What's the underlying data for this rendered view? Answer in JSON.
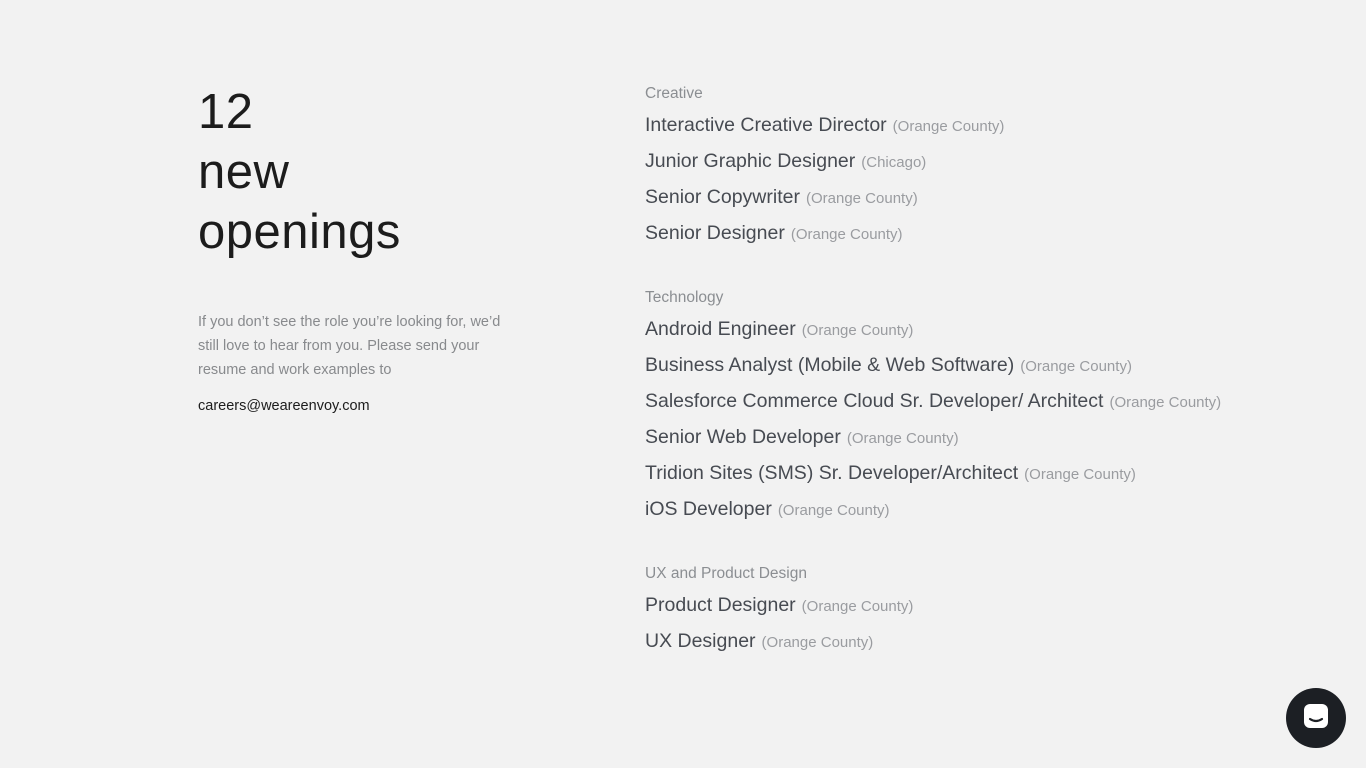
{
  "headline": {
    "line1": "12",
    "line2": "new",
    "line3": "openings"
  },
  "intro": {
    "text": "If you don’t see the role you’re looking for, we’d still love to hear from you. Please send your resume and work examples to",
    "email": "careers@weareenvoy.com"
  },
  "departments": [
    {
      "name": "Creative",
      "jobs": [
        {
          "title": "Interactive Creative Director",
          "location": "(Orange County)"
        },
        {
          "title": "Junior Graphic Designer",
          "location": "(Chicago)"
        },
        {
          "title": "Senior Copywriter",
          "location": "(Orange County)"
        },
        {
          "title": "Senior Designer",
          "location": "(Orange County)"
        }
      ]
    },
    {
      "name": "Technology",
      "jobs": [
        {
          "title": "Android Engineer",
          "location": "(Orange County)"
        },
        {
          "title": "Business Analyst (Mobile & Web Software)",
          "location": "(Orange County)"
        },
        {
          "title": "Salesforce Commerce Cloud Sr. Developer/ Architect",
          "location": "(Orange County)"
        },
        {
          "title": "Senior Web Developer",
          "location": "(Orange County)"
        },
        {
          "title": "Tridion Sites (SMS) Sr. Developer/Architect",
          "location": "(Orange County)"
        },
        {
          "title": "iOS Developer",
          "location": "(Orange County)"
        }
      ]
    },
    {
      "name": "UX and Product Design",
      "jobs": [
        {
          "title": "Product Designer",
          "location": "(Orange County)"
        },
        {
          "title": "UX Designer",
          "location": "(Orange County)"
        }
      ]
    }
  ],
  "chat": {
    "icon": "chat-bubble-icon",
    "bg_color": "#1c1f24"
  }
}
